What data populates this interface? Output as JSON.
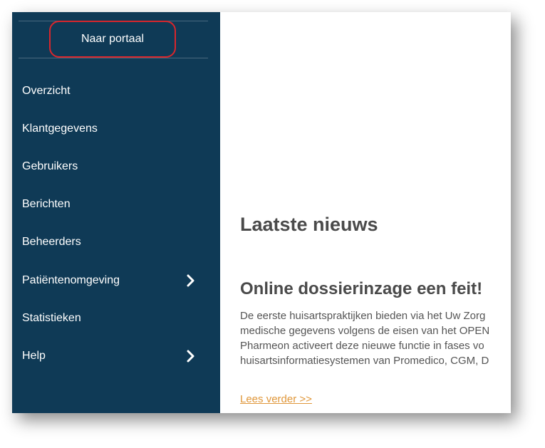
{
  "sidebar": {
    "portal_button": "Naar portaal",
    "items": [
      {
        "label": "Overzicht",
        "has_submenu": false
      },
      {
        "label": "Klantgegevens",
        "has_submenu": false
      },
      {
        "label": "Gebruikers",
        "has_submenu": false
      },
      {
        "label": "Berichten",
        "has_submenu": false
      },
      {
        "label": "Beheerders",
        "has_submenu": false
      },
      {
        "label": "Patiëntenomgeving",
        "has_submenu": true
      },
      {
        "label": "Statistieken",
        "has_submenu": false
      },
      {
        "label": "Help",
        "has_submenu": true
      }
    ]
  },
  "main": {
    "news_heading": "Laatste nieuws",
    "article": {
      "title": "Online dossierinzage een feit!",
      "lines": [
        "De eerste huisartspraktijken bieden via het Uw Zorg",
        "medische gegevens volgens de eisen van het OPEN",
        "Pharmeon activeert deze nieuwe functie in fases vo",
        "huisartsinformatiesystemen van Promedico, CGM, D"
      ],
      "read_more": "Lees verder >>"
    }
  },
  "colors": {
    "sidebar_bg": "#0f3a56",
    "highlight_border": "#d9262c",
    "link": "#e0973a",
    "heading": "#4a4a4a"
  },
  "icons": {
    "submenu": "chevron-right-icon"
  }
}
